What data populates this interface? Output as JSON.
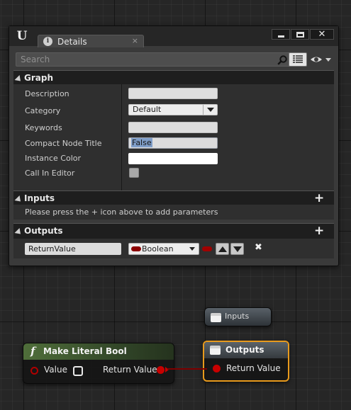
{
  "window": {
    "tab_label": "Details",
    "tab_close": "×",
    "search_placeholder": "Search",
    "close_glyph": "✕"
  },
  "graph_section": {
    "title": "Graph",
    "properties": [
      {
        "label": "Description",
        "value": ""
      },
      {
        "label": "Category",
        "value": "Default"
      },
      {
        "label": "Keywords",
        "value": ""
      },
      {
        "label": "Compact Node Title",
        "value": "False"
      },
      {
        "label": "Instance Color",
        "value": "#FFFFFF"
      },
      {
        "label": "Call In Editor",
        "value": false
      }
    ]
  },
  "inputs_section": {
    "title": "Inputs",
    "hint": "Please press the + icon above to add parameters"
  },
  "outputs_section": {
    "title": "Outputs",
    "param_name": "ReturnValue",
    "param_type": "Boolean",
    "delete_glyph": "✖"
  },
  "nodes": {
    "inputs_title": "Inputs",
    "outputs_title": "Outputs",
    "outputs_pin": "Return Value",
    "bool_title": "Make Literal Bool",
    "bool_func_glyph": "f",
    "bool_in_pin": "Value",
    "bool_out_pin": "Return Value"
  },
  "colors": {
    "boolean_pin": "#c80000",
    "selected_node_outline": "#e89a1c",
    "function_header": "#4f6e3a"
  },
  "icons": [
    "unreal-logo-icon",
    "info-icon",
    "search-icon",
    "grid-view-icon",
    "eye-icon",
    "plus-icon",
    "delete-icon"
  ]
}
